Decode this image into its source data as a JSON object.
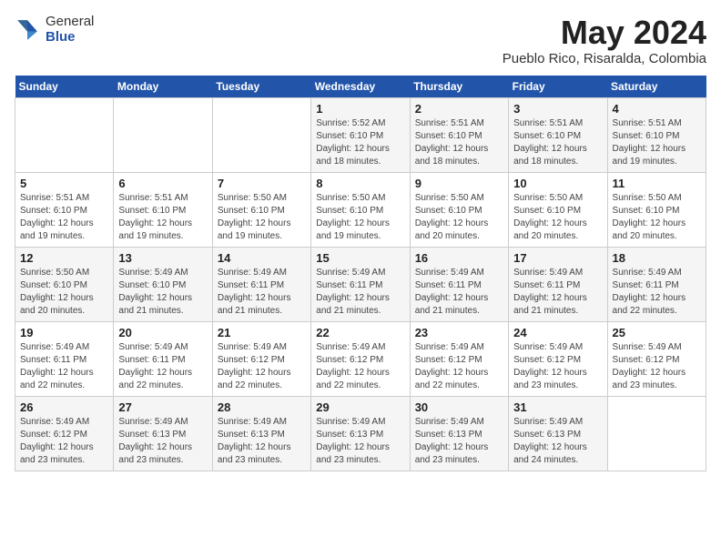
{
  "header": {
    "logo_general": "General",
    "logo_blue": "Blue",
    "title": "May 2024",
    "subtitle": "Pueblo Rico, Risaralda, Colombia"
  },
  "weekdays": [
    "Sunday",
    "Monday",
    "Tuesday",
    "Wednesday",
    "Thursday",
    "Friday",
    "Saturday"
  ],
  "weeks": [
    [
      {
        "day": "",
        "sunrise": "",
        "sunset": "",
        "daylight": ""
      },
      {
        "day": "",
        "sunrise": "",
        "sunset": "",
        "daylight": ""
      },
      {
        "day": "",
        "sunrise": "",
        "sunset": "",
        "daylight": ""
      },
      {
        "day": "1",
        "sunrise": "5:52 AM",
        "sunset": "6:10 PM",
        "daylight": "12 hours and 18 minutes."
      },
      {
        "day": "2",
        "sunrise": "5:51 AM",
        "sunset": "6:10 PM",
        "daylight": "12 hours and 18 minutes."
      },
      {
        "day": "3",
        "sunrise": "5:51 AM",
        "sunset": "6:10 PM",
        "daylight": "12 hours and 18 minutes."
      },
      {
        "day": "4",
        "sunrise": "5:51 AM",
        "sunset": "6:10 PM",
        "daylight": "12 hours and 19 minutes."
      }
    ],
    [
      {
        "day": "5",
        "sunrise": "5:51 AM",
        "sunset": "6:10 PM",
        "daylight": "12 hours and 19 minutes."
      },
      {
        "day": "6",
        "sunrise": "5:51 AM",
        "sunset": "6:10 PM",
        "daylight": "12 hours and 19 minutes."
      },
      {
        "day": "7",
        "sunrise": "5:50 AM",
        "sunset": "6:10 PM",
        "daylight": "12 hours and 19 minutes."
      },
      {
        "day": "8",
        "sunrise": "5:50 AM",
        "sunset": "6:10 PM",
        "daylight": "12 hours and 19 minutes."
      },
      {
        "day": "9",
        "sunrise": "5:50 AM",
        "sunset": "6:10 PM",
        "daylight": "12 hours and 20 minutes."
      },
      {
        "day": "10",
        "sunrise": "5:50 AM",
        "sunset": "6:10 PM",
        "daylight": "12 hours and 20 minutes."
      },
      {
        "day": "11",
        "sunrise": "5:50 AM",
        "sunset": "6:10 PM",
        "daylight": "12 hours and 20 minutes."
      }
    ],
    [
      {
        "day": "12",
        "sunrise": "5:50 AM",
        "sunset": "6:10 PM",
        "daylight": "12 hours and 20 minutes."
      },
      {
        "day": "13",
        "sunrise": "5:49 AM",
        "sunset": "6:10 PM",
        "daylight": "12 hours and 21 minutes."
      },
      {
        "day": "14",
        "sunrise": "5:49 AM",
        "sunset": "6:11 PM",
        "daylight": "12 hours and 21 minutes."
      },
      {
        "day": "15",
        "sunrise": "5:49 AM",
        "sunset": "6:11 PM",
        "daylight": "12 hours and 21 minutes."
      },
      {
        "day": "16",
        "sunrise": "5:49 AM",
        "sunset": "6:11 PM",
        "daylight": "12 hours and 21 minutes."
      },
      {
        "day": "17",
        "sunrise": "5:49 AM",
        "sunset": "6:11 PM",
        "daylight": "12 hours and 21 minutes."
      },
      {
        "day": "18",
        "sunrise": "5:49 AM",
        "sunset": "6:11 PM",
        "daylight": "12 hours and 22 minutes."
      }
    ],
    [
      {
        "day": "19",
        "sunrise": "5:49 AM",
        "sunset": "6:11 PM",
        "daylight": "12 hours and 22 minutes."
      },
      {
        "day": "20",
        "sunrise": "5:49 AM",
        "sunset": "6:11 PM",
        "daylight": "12 hours and 22 minutes."
      },
      {
        "day": "21",
        "sunrise": "5:49 AM",
        "sunset": "6:12 PM",
        "daylight": "12 hours and 22 minutes."
      },
      {
        "day": "22",
        "sunrise": "5:49 AM",
        "sunset": "6:12 PM",
        "daylight": "12 hours and 22 minutes."
      },
      {
        "day": "23",
        "sunrise": "5:49 AM",
        "sunset": "6:12 PM",
        "daylight": "12 hours and 22 minutes."
      },
      {
        "day": "24",
        "sunrise": "5:49 AM",
        "sunset": "6:12 PM",
        "daylight": "12 hours and 23 minutes."
      },
      {
        "day": "25",
        "sunrise": "5:49 AM",
        "sunset": "6:12 PM",
        "daylight": "12 hours and 23 minutes."
      }
    ],
    [
      {
        "day": "26",
        "sunrise": "5:49 AM",
        "sunset": "6:12 PM",
        "daylight": "12 hours and 23 minutes."
      },
      {
        "day": "27",
        "sunrise": "5:49 AM",
        "sunset": "6:13 PM",
        "daylight": "12 hours and 23 minutes."
      },
      {
        "day": "28",
        "sunrise": "5:49 AM",
        "sunset": "6:13 PM",
        "daylight": "12 hours and 23 minutes."
      },
      {
        "day": "29",
        "sunrise": "5:49 AM",
        "sunset": "6:13 PM",
        "daylight": "12 hours and 23 minutes."
      },
      {
        "day": "30",
        "sunrise": "5:49 AM",
        "sunset": "6:13 PM",
        "daylight": "12 hours and 23 minutes."
      },
      {
        "day": "31",
        "sunrise": "5:49 AM",
        "sunset": "6:13 PM",
        "daylight": "12 hours and 24 minutes."
      },
      {
        "day": "",
        "sunrise": "",
        "sunset": "",
        "daylight": ""
      }
    ]
  ],
  "labels": {
    "sunrise": "Sunrise:",
    "sunset": "Sunset:",
    "daylight": "Daylight:"
  }
}
